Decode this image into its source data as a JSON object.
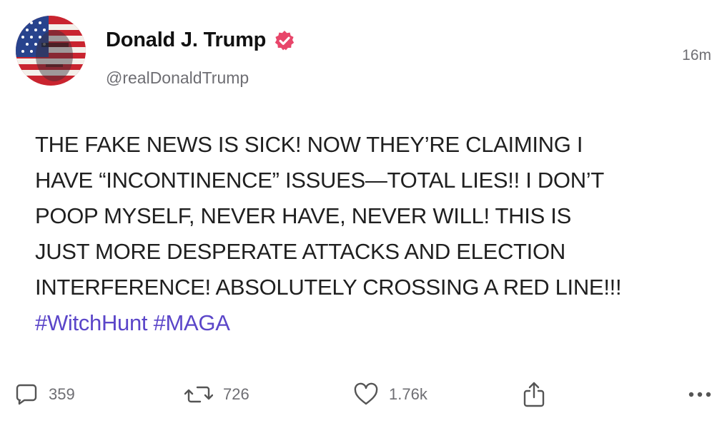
{
  "author": {
    "display_name": "Donald J. Trump",
    "handle": "@realDonaldTrump",
    "verified": true
  },
  "timestamp": "16m",
  "post": {
    "lines": [
      "THE FAKE NEWS IS SICK! NOW THEY’RE CLAIMING I",
      "HAVE “INCONTINENCE” ISSUES—TOTAL LIES!! I DON’T",
      "POOP MYSELF, NEVER HAVE, NEVER WILL! THIS IS",
      "JUST MORE DESPERATE ATTACKS AND ELECTION",
      "INTERFERENCE! ABSOLUTELY CROSSING A RED LINE!!!"
    ],
    "hashtags": [
      "#WitchHunt",
      "#MAGA"
    ]
  },
  "actions": {
    "replies": "359",
    "reposts": "726",
    "likes": "1.76k"
  },
  "icons": {
    "reply": "comment-icon",
    "repost": "repost-icon",
    "like": "heart-icon",
    "share": "share-icon",
    "more": "more-icon",
    "verified": "verified-badge-icon"
  },
  "colors": {
    "verified_badge": "#e8466a",
    "hashtag": "#5b46c9",
    "muted_text": "#6e6e73"
  }
}
